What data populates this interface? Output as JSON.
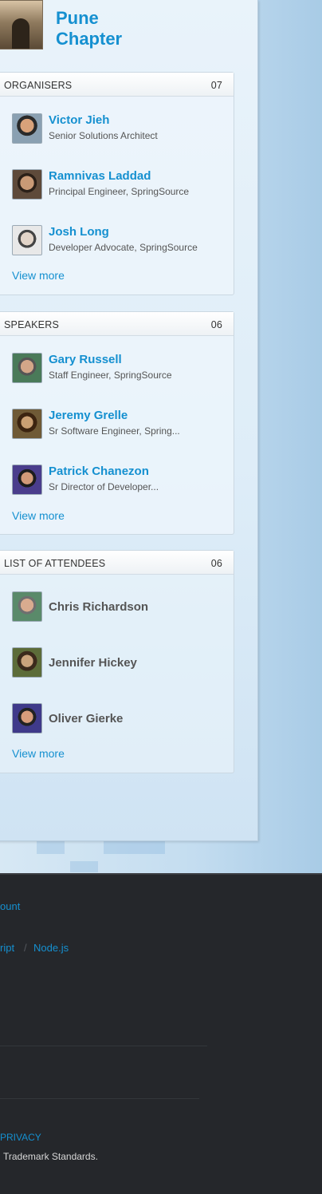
{
  "chapter": {
    "title": "Pune Chapter"
  },
  "organisers": {
    "heading": "ORGANISERS",
    "count": "07",
    "people": [
      {
        "name": "Victor Jieh",
        "role": "Senior Solutions Architect"
      },
      {
        "name": "Ramnivas Laddad",
        "role": "Principal Engineer, SpringSource"
      },
      {
        "name": "Josh Long",
        "role": "Developer Advocate, SpringSource"
      }
    ],
    "view_more": "View more"
  },
  "speakers": {
    "heading": "SPEAKERS",
    "count": "06",
    "people": [
      {
        "name": "Gary Russell",
        "role": "Staff Engineer, SpringSource"
      },
      {
        "name": "Jeremy Grelle",
        "role": "Sr Software Engineer, Spring..."
      },
      {
        "name": "Patrick Chanezon",
        "role": "Sr Director of Developer..."
      }
    ],
    "view_more": "View more"
  },
  "attendees": {
    "heading": "LIST OF ATTENDEES",
    "count": "06",
    "people": [
      {
        "name": "Chris Richardson"
      },
      {
        "name": "Jennifer Hickey"
      },
      {
        "name": "Oliver Gierke"
      }
    ],
    "view_more": "View more"
  },
  "footer": {
    "link_account": "ount",
    "link_script": "ript",
    "separator": "/",
    "link_node": "Node.js",
    "link_privacy": "PRIVACY",
    "trademark_text": "Trademark Standards."
  },
  "colors": {
    "accent": "#1590d0",
    "footer_bg": "#25272b"
  }
}
